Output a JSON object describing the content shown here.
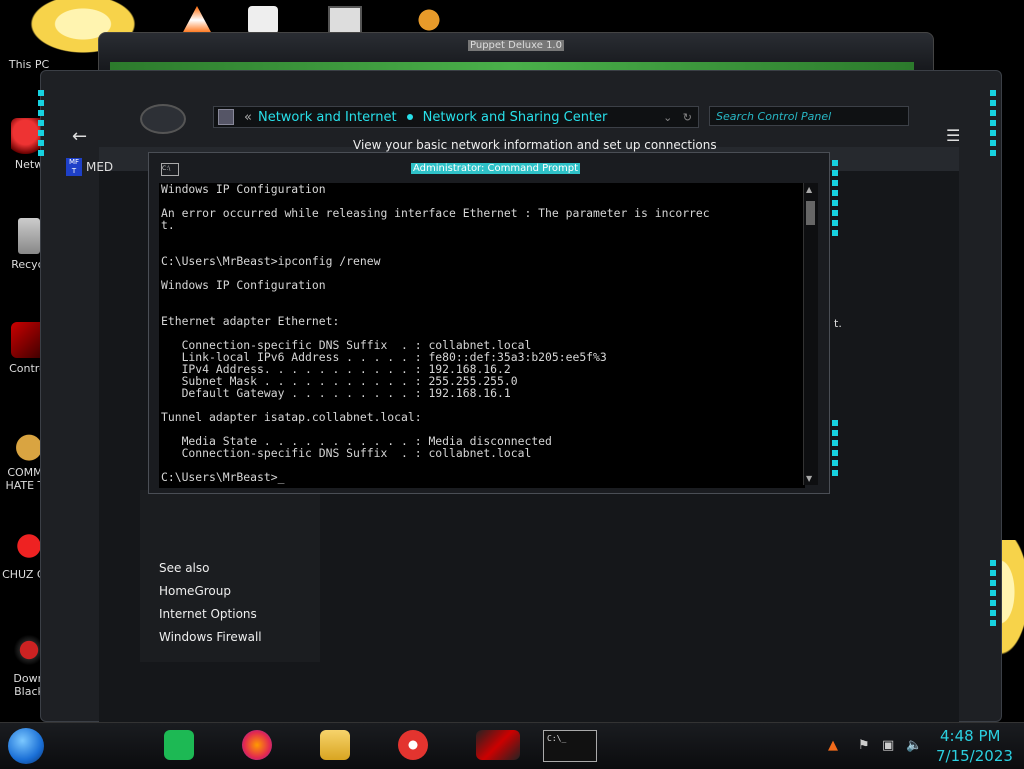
{
  "desktop": {
    "icons": [
      {
        "label": "This PC"
      },
      {
        "label": "Netw"
      },
      {
        "label": "Recycl"
      },
      {
        "label": "Control"
      },
      {
        "label": "COMMU HATE TH"
      },
      {
        "label": "CHUZ CUI"
      },
      {
        "label": "Down Black"
      }
    ]
  },
  "back_window": {
    "title": "Puppet Deluxe 1.0"
  },
  "control_panel": {
    "breadcrumb_root": "Network and Internet",
    "breadcrumb_current": "Network and Sharing Center",
    "search_placeholder": "Search Control Panel",
    "heading": "View your basic network information and set up connections",
    "side_label": "MED",
    "trailing_text": "t.",
    "see_also": {
      "title": "See also",
      "links": [
        "HomeGroup",
        "Internet Options",
        "Windows Firewall"
      ]
    }
  },
  "cmd": {
    "title": "Administrator: Command Prompt",
    "lines": [
      "Windows IP Configuration",
      "",
      "An error occurred while releasing interface Ethernet : The parameter is incorrec",
      "t.",
      "",
      "",
      "C:\\Users\\MrBeast>ipconfig /renew",
      "",
      "Windows IP Configuration",
      "",
      "",
      "Ethernet adapter Ethernet:",
      "",
      "   Connection-specific DNS Suffix  . : collabnet.local",
      "   Link-local IPv6 Address . . . . . : fe80::def:35a3:b205:ee5f%3",
      "   IPv4 Address. . . . . . . . . . . : 192.168.16.2",
      "   Subnet Mask . . . . . . . . . . . : 255.255.255.0",
      "   Default Gateway . . . . . . . . . : 192.168.16.1",
      "",
      "Tunnel adapter isatap.collabnet.local:",
      "",
      "   Media State . . . . . . . . . . . : Media disconnected",
      "   Connection-specific DNS Suffix  . : collabnet.local",
      "",
      "C:\\Users\\MrBeast>_"
    ]
  },
  "taskbar": {
    "cmd_label": "C:\\_",
    "time": "4:48 PM",
    "date": "7/15/2023"
  },
  "colors": {
    "accent": "#28e0ea",
    "frame": "#1e2024"
  }
}
